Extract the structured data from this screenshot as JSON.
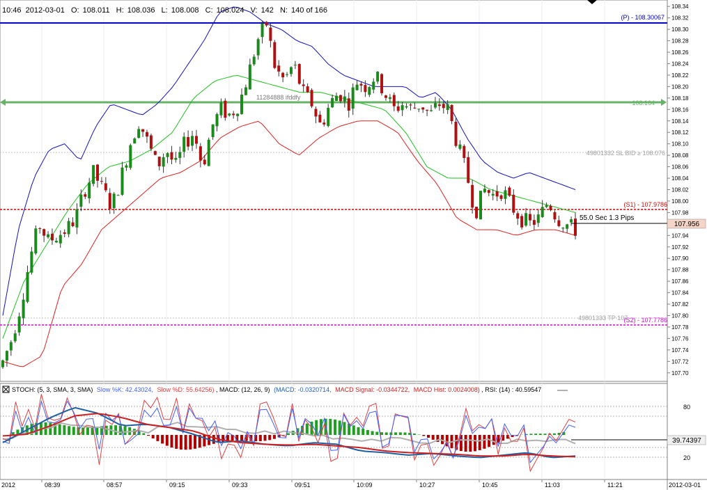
{
  "header": {
    "time": "10:46",
    "date": "2012-03-01",
    "open_label": "O:",
    "open": "108.011",
    "high_label": "H:",
    "high": "108.036",
    "low_label": "L:",
    "low": "108.008",
    "close_label": "C:",
    "close": "108.024",
    "volume_label": "V:",
    "volume": "142",
    "bar_label": "N:",
    "bar_position": "140 of 166"
  },
  "colors": {
    "up_candle": "#1a8a1a",
    "down_candle": "#b01010",
    "upper_band": "#1010c0",
    "middle_band": "#20c020",
    "lower_band": "#e02020",
    "pivot_line": "#0000cc",
    "level_line_green": "#55aa55",
    "s1_line": "#dd0000",
    "s2_line": "#dd00dd",
    "stoch_k": "#e04040",
    "stoch_d": "#ff8080",
    "macd": "#2060c0",
    "macd_signal": "#cc2020",
    "macd_hist_pos": "#20a020",
    "macd_hist_neg": "#b00000",
    "rsi": "#b0b0b0"
  },
  "price_panel": {
    "level_labels": {
      "pivot": "(P) - 108.30067",
      "level_108164": "108.164",
      "sl_order": "49801332 SL BID ≥ 108.076",
      "s1": "(S1) - 107.9786",
      "tp_order": "49801333 TP 107",
      "s2": "(S2) - 107.7786",
      "order_text": "11284888 ifddfy",
      "timer_text": "55.0 Sec 1.3 Pips",
      "current_price": "107.956"
    }
  },
  "indicator_panel": {
    "legend_stoch": "STOCH: (5, 3, SMA, 3, SMA)",
    "legend_slow_k": "Slow %K: 42.43024,",
    "legend_slow_d": "Slow %D: 55.64256)",
    "legend_macd": ", MACD: (12, 26, 9)",
    "legend_macd_val": "(MACD: -0.0320714,",
    "legend_macd_signal": "MACD Signal: -0.0344722,",
    "legend_macd_hist": "MACD Hist: 0.0024008)",
    "legend_rsi": ", RSI: (14) : 40.59547",
    "current_value": "39.74397",
    "ticks": [
      "80",
      "20"
    ]
  },
  "x_axis": {
    "labels": [
      "2012",
      "08:39",
      "08:57",
      "09:15",
      "09:33",
      "09:51",
      "10:09",
      "10:27",
      "10:45",
      "11:03",
      "11:21",
      "2012-03-01"
    ]
  },
  "chart_data": {
    "type": "line",
    "title": "",
    "xlabel": "",
    "ylabel": "",
    "ylim": [
      107.69,
      108.35
    ],
    "y_ticks": [
      "108.34",
      "108.32",
      "108.30",
      "108.28",
      "108.26",
      "108.24",
      "108.22",
      "108.20",
      "108.18",
      "108.16",
      "108.14",
      "108.12",
      "108.10",
      "108.08",
      "108.06",
      "108.04",
      "108.02",
      "108.00",
      "107.98",
      "107.96",
      "107.94",
      "107.92",
      "107.90",
      "107.88",
      "107.86",
      "107.84",
      "107.82",
      "107.80",
      "107.78",
      "107.76",
      "107.74",
      "107.72",
      "107.70"
    ],
    "x_ticks": [
      "08:39",
      "08:57",
      "09:15",
      "09:33",
      "09:51",
      "10:09",
      "10:27",
      "10:45",
      "11:03",
      "11:21"
    ],
    "candles_total": 166,
    "candles_shown": 140,
    "close_path": [
      107.72,
      107.76,
      107.82,
      107.9,
      107.96,
      107.93,
      107.94,
      107.95,
      107.97,
      108.02,
      108.05,
      108.02,
      107.99,
      108.04,
      108.1,
      108.14,
      108.1,
      108.06,
      108.09,
      108.06,
      108.1,
      108.12,
      108.06,
      108.13,
      108.16,
      108.15,
      108.17,
      108.22,
      108.28,
      108.31,
      108.23,
      108.21,
      108.24,
      108.19,
      108.17,
      108.13,
      108.17,
      108.19,
      108.17,
      108.21,
      108.2,
      108.22,
      108.19,
      108.16,
      108.17,
      108.16,
      108.17,
      108.15,
      108.17,
      108.16,
      108.1,
      108.05,
      107.98,
      108.02,
      108.01,
      108.02,
      107.99,
      107.97,
      107.96,
      107.97,
      108.0,
      107.97,
      107.96,
      107.95
    ],
    "upper_band_path": [
      107.8,
      107.95,
      108.04,
      108.09,
      108.1,
      108.07,
      108.13,
      108.17,
      108.16,
      108.15,
      108.17,
      108.2,
      108.24,
      108.28,
      108.33,
      108.34,
      108.33,
      108.31,
      108.3,
      108.28,
      108.27,
      108.24,
      108.22,
      108.21,
      108.2,
      108.2,
      108.2,
      108.18,
      108.19,
      108.16,
      108.11,
      108.07,
      108.05,
      108.04,
      108.05,
      108.04,
      108.03,
      108.02
    ],
    "middle_band_path": [
      107.76,
      107.86,
      107.92,
      107.98,
      108.03,
      108.06,
      108.07,
      108.09,
      108.12,
      108.18,
      108.21,
      108.22,
      108.21,
      108.2,
      108.19,
      108.19,
      108.18,
      108.17,
      108.16,
      108.12,
      108.06,
      108.04,
      108.04,
      108.02,
      108.01,
      108.0,
      107.99,
      107.98
    ],
    "lower_band_path": [
      107.72,
      107.71,
      107.73,
      107.85,
      107.89,
      107.95,
      107.98,
      108.01,
      108.04,
      108.05,
      108.07,
      108.11,
      108.13,
      108.14,
      108.1,
      108.08,
      108.11,
      108.13,
      108.14,
      108.14,
      108.12,
      108.07,
      108.03,
      107.97,
      107.95,
      107.95,
      107.94,
      107.95,
      107.95,
      107.94
    ],
    "reference_levels": [
      {
        "label": "(P) - 108.30067",
        "value": 108.30067
      },
      {
        "label": "108.164",
        "value": 108.164
      },
      {
        "label": "(S1) - 107.9786",
        "value": 107.9786
      },
      {
        "label": "(S2) - 107.7786",
        "value": 107.7786
      }
    ],
    "indicator_ticks": [
      80,
      20
    ],
    "indicator_series": [
      {
        "name": "Slow %K",
        "values": [
          55,
          70,
          75,
          60,
          40,
          60,
          75,
          80,
          65,
          45,
          55,
          70,
          60,
          45,
          50,
          60,
          45,
          35,
          50,
          55,
          40,
          30,
          40,
          45
        ]
      },
      {
        "name": "Slow %D",
        "values": [
          50,
          62,
          70,
          65,
          55,
          55,
          65,
          72,
          68,
          58,
          55,
          62,
          62,
          55,
          50,
          55,
          50,
          42,
          45,
          52,
          48,
          38,
          38,
          42
        ]
      },
      {
        "name": "RSI",
        "values": [
          45,
          50,
          60,
          62,
          55,
          52,
          55,
          62,
          60,
          55,
          52,
          53,
          51,
          48,
          45,
          44,
          43,
          41,
          42,
          43,
          42,
          41,
          41,
          41
        ]
      }
    ]
  }
}
